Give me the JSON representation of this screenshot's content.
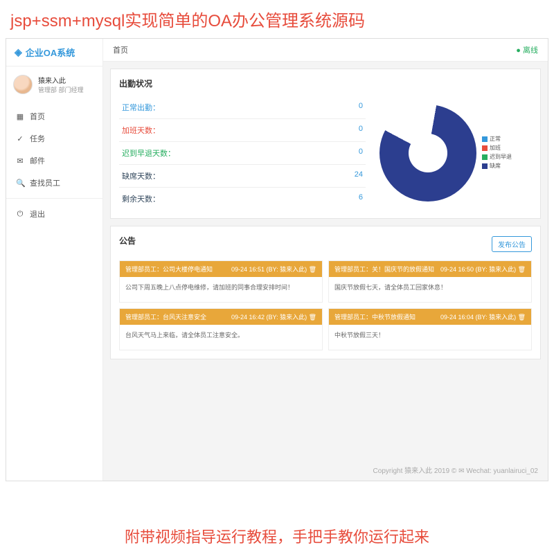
{
  "banner_top": "jsp+ssm+mysql实现简单的OA办公管理系统源码",
  "banner_bottom": "附带视频指导运行教程，手把手教你运行起来",
  "app_name": "企业OA系统",
  "user": {
    "name": "猿来入此",
    "role": "管理部 部门经理"
  },
  "nav": {
    "home": "首页",
    "tasks": "任务",
    "mail": "邮件",
    "search_emp": "查找员工",
    "logout": "退出"
  },
  "topbar": {
    "breadcrumb": "首页",
    "online": "● 离线"
  },
  "attendance": {
    "title": "出勤状况",
    "rows": [
      {
        "label": "正常出勤：",
        "value": "0",
        "cls": "c-blue"
      },
      {
        "label": "加班天数：",
        "value": "0",
        "cls": "c-red"
      },
      {
        "label": "迟到早退天数：",
        "value": "0",
        "cls": "c-green"
      },
      {
        "label": "缺席天数：",
        "value": "24",
        "cls": "c-dark"
      },
      {
        "label": "剩余天数：",
        "value": "6",
        "cls": "c-dark"
      }
    ],
    "legend": [
      {
        "label": "正常",
        "color": "#3498db"
      },
      {
        "label": "加班",
        "color": "#e74c3c"
      },
      {
        "label": "迟到早退",
        "color": "#27ae60"
      },
      {
        "label": "缺席",
        "color": "#2c3e8f"
      }
    ]
  },
  "chart_data": {
    "type": "pie",
    "title": "出勤状况",
    "categories": [
      "正常",
      "加班",
      "迟到早退",
      "缺席",
      "剩余"
    ],
    "values": [
      0,
      0,
      0,
      24,
      6
    ],
    "colors": [
      "#3498db",
      "#e74c3c",
      "#27ae60",
      "#2c3e8f",
      "#ffffff"
    ]
  },
  "notices": {
    "title": "公告",
    "publish_btn": "发布公告",
    "items": [
      {
        "dept": "管理部员工：",
        "subject": "公司大楼停电通知",
        "meta": "09-24 16:51 (BY: 猿来入此)",
        "body": "公司下周五晚上八点停电维修，请加班的同事合理安排时间！"
      },
      {
        "dept": "管理部员工：",
        "subject": "关！国庆节的放假通知",
        "meta": "09-24 16:50 (BY: 猿来入此)",
        "body": "国庆节放假七天，请全体员工回家休息！"
      },
      {
        "dept": "管理部员工：",
        "subject": "台风天注意安全",
        "meta": "09-24 16:42 (BY: 猿来入此)",
        "body": "台风天气马上来临，请全体员工注意安全。"
      },
      {
        "dept": "管理部员工：",
        "subject": "中秋节放假通知",
        "meta": "09-24 16:04 (BY: 猿来入此)",
        "body": "中秋节放假三天！"
      }
    ]
  },
  "footer": "Copyright 猿来入此 2019 ©   ✉ Wechat: yuanlairuci_02"
}
